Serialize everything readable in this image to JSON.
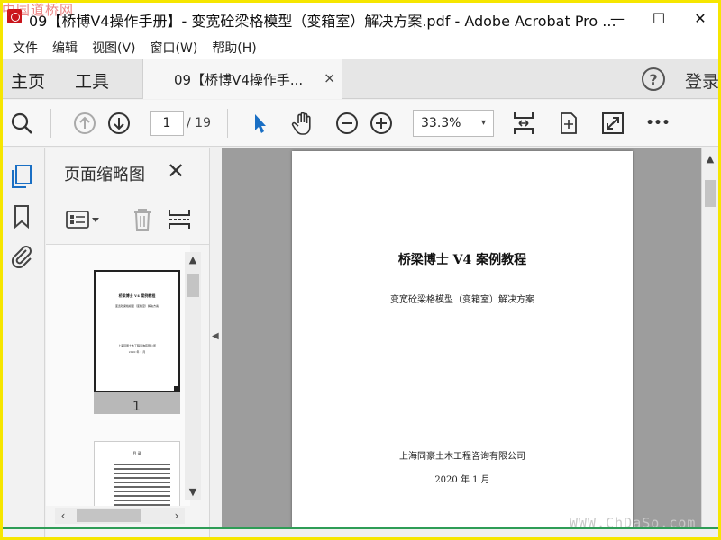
{
  "window": {
    "title": "09【桥博V4操作手册】- 变宽砼梁格模型（变箱室）解决方案.pdf - Adobe Acrobat Pro ...",
    "minimize": "—",
    "maximize": "☐",
    "close": "✕",
    "corner_watermark": "中国道桥网"
  },
  "menu": [
    "文件",
    "编辑",
    "视图(V)",
    "窗口(W)",
    "帮助(H)"
  ],
  "nav": {
    "home": "主页",
    "tools": "工具",
    "doc_tab": "09【桥博V4操作手...",
    "doc_tab_close": "×",
    "help": "?",
    "login": "登录"
  },
  "toolbar": {
    "current_page": "1",
    "total_pages": "/ 19",
    "zoom": "33.3%",
    "zoom_caret": "▾",
    "more": "•••",
    "icons": [
      "search-icon",
      "page-up-icon",
      "page-down-icon",
      "select-arrow-icon",
      "hand-tool-icon",
      "zoom-out-icon",
      "zoom-in-icon",
      "fit-page-icon",
      "rotate-icon",
      "fullscreen-icon",
      "more-icon"
    ]
  },
  "left_rail": {
    "icons": [
      "page-thumbnails-icon",
      "bookmark-icon",
      "attachment-icon"
    ],
    "accent": "#1a6fc4"
  },
  "thumbnails_panel": {
    "title": "页面缩略图",
    "close": "✕",
    "thumb1_label": "1",
    "thumb1_text_title": "桥梁博士 V4 案例教程",
    "thumb1_text_subtitle": "变宽砼梁格模型（变箱室）解决方案",
    "thumb1_text_company": "上海同豪土木工程咨询有限公司",
    "thumb1_text_date": "2020 年 1 月",
    "thumb2_heading": "目 录"
  },
  "document": {
    "title": "桥梁博士 V4 案例教程",
    "subtitle": "变宽砼梁格模型（变箱室）解决方案",
    "company": "上海同豪土木工程咨询有限公司",
    "date": "2020 年 1 月"
  },
  "watermark": "WWW.ChDaSo.com"
}
